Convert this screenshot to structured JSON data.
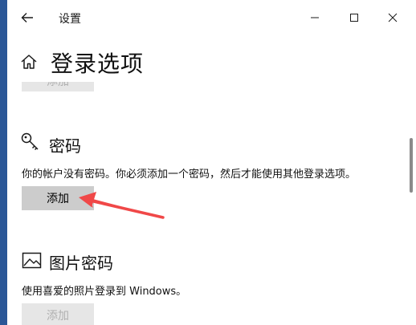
{
  "window": {
    "app_title": "设置"
  },
  "header": {
    "page_title": "登录选项"
  },
  "sections": {
    "prev": {
      "button_label": "添加"
    },
    "password": {
      "title": "密码",
      "description": "你的帐户没有密码。你必须添加一个密码，然后才能使用其他登录选项。",
      "button_label": "添加"
    },
    "picture_password": {
      "title": "图片密码",
      "description": "使用喜爱的照片登录到 Windows。",
      "button_label": "添加"
    }
  },
  "icons": {
    "back": "back-arrow-icon",
    "minimize": "minimize-icon",
    "maximize": "maximize-icon",
    "close": "close-icon",
    "home": "home-icon",
    "key": "key-icon",
    "picture": "picture-icon"
  },
  "colors": {
    "desktop_background": "#2b5797",
    "window_background": "#ffffff",
    "button_background": "#cccccc",
    "button_disabled_background": "#e6e6e6",
    "annotation_arrow": "#f04848"
  }
}
